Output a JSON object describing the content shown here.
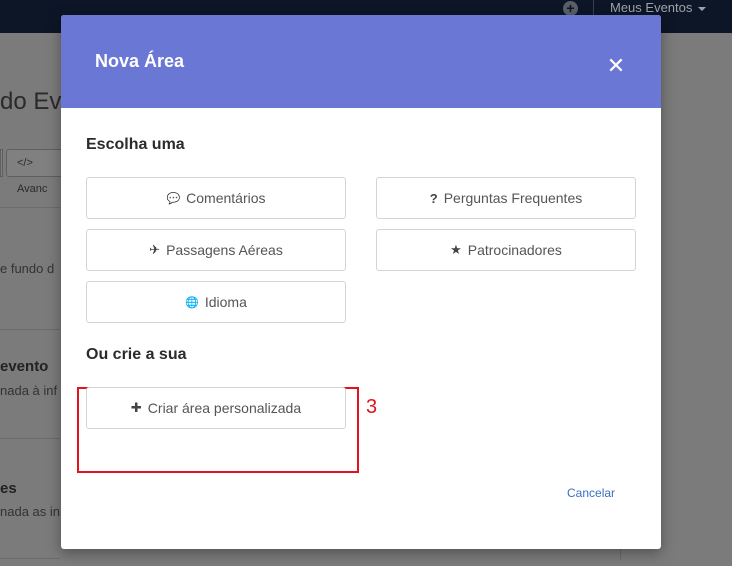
{
  "topbar": {
    "menu_label": "Meus Eventos"
  },
  "background": {
    "title": "do Eve",
    "advanced_btn": "</> Avanc",
    "text1": "e fundo d",
    "bold1": "evento",
    "text2": "nada à inf",
    "bold2": "es",
    "text3": "nada as in"
  },
  "modal": {
    "title": "Nova Área",
    "close_icon": "✕",
    "section_choose": "Escolha uma",
    "options": [
      {
        "label": "Comentários",
        "icon": "comment-icon",
        "glyph": "💬"
      },
      {
        "label": "Perguntas Frequentes",
        "icon": "question-icon",
        "glyph": "?"
      },
      {
        "label": "Passagens Aéreas",
        "icon": "plane-icon",
        "glyph": "✈"
      },
      {
        "label": "Patrocinadores",
        "icon": "star-icon",
        "glyph": "★"
      },
      {
        "label": "Idioma",
        "icon": "globe-icon",
        "glyph": "🌐"
      }
    ],
    "section_create": "Ou crie a sua",
    "create_button": {
      "label": "Criar área personalizada",
      "icon": "plus-icon",
      "glyph": "✚"
    },
    "annotation_number": "3",
    "cancel_label": "Cancelar"
  },
  "colors": {
    "header": "#6a77d5",
    "highlight": "#e0141e",
    "link": "#3a6fc4"
  }
}
